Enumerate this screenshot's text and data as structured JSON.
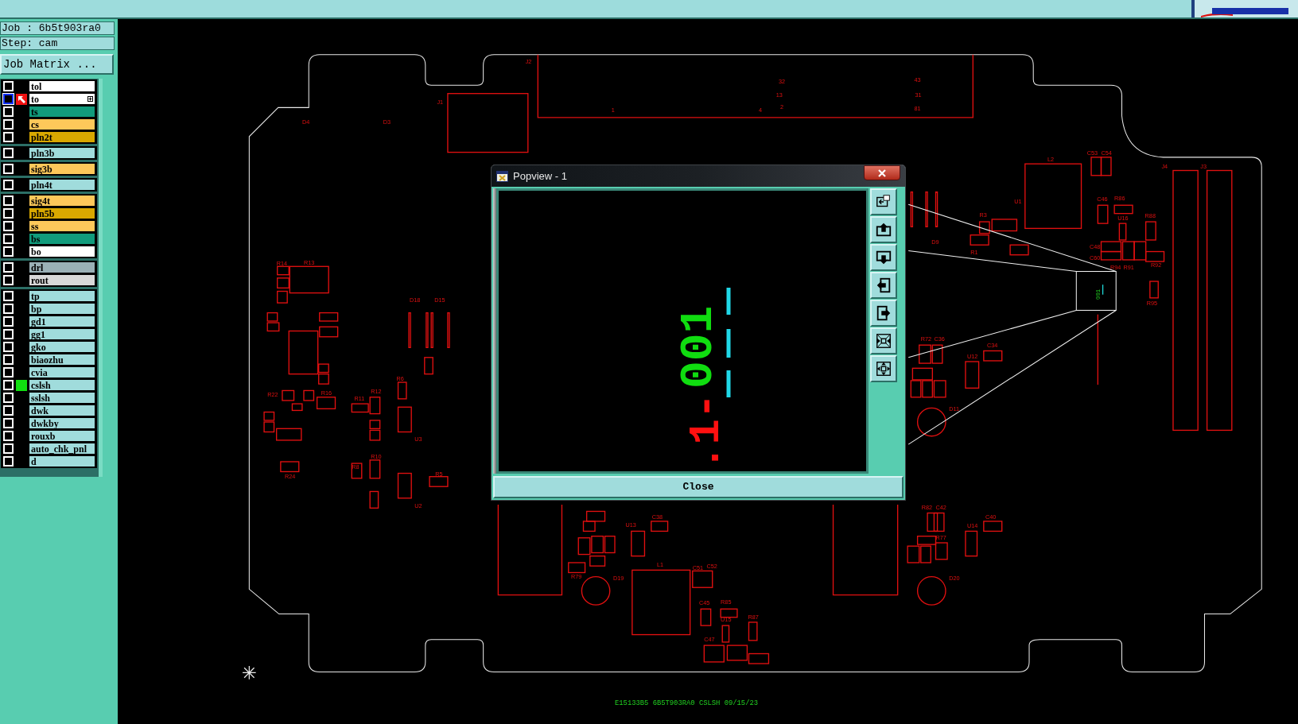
{
  "job_info": {
    "job": "Job : 6b5t903ra0",
    "step": "Step: cam"
  },
  "job_matrix_button": "Job Matrix ...",
  "layer_groups": [
    [
      {
        "name": "tol",
        "color": "#ffffff",
        "checked": false,
        "work": false,
        "affected": false
      },
      {
        "name": "to",
        "color": "#ffffff",
        "checked": false,
        "work": true,
        "affected": false
      },
      {
        "name": "ts",
        "color": "#119b7c",
        "checked": false,
        "work": false,
        "affected": false
      },
      {
        "name": "cs",
        "color": "#fdc85a",
        "checked": false,
        "work": false,
        "affected": false
      },
      {
        "name": "pln2t",
        "color": "#d9a800",
        "checked": false,
        "work": false,
        "affected": false
      }
    ],
    [
      {
        "name": "pln3b",
        "color": "#a0dcdc",
        "checked": false,
        "work": false,
        "affected": false
      }
    ],
    [
      {
        "name": "sig3b",
        "color": "#fdc85a",
        "checked": false,
        "work": false,
        "affected": false
      }
    ],
    [
      {
        "name": "pln4t",
        "color": "#a0dcdc",
        "checked": false,
        "work": false,
        "affected": false
      }
    ],
    [
      {
        "name": "sig4t",
        "color": "#fdc85a",
        "checked": false,
        "work": false,
        "affected": false
      },
      {
        "name": "pln5b",
        "color": "#d9a800",
        "checked": false,
        "work": false,
        "affected": false
      },
      {
        "name": "ss",
        "color": "#fdc85a",
        "checked": false,
        "work": false,
        "affected": false
      },
      {
        "name": "bs",
        "color": "#119b7c",
        "checked": false,
        "work": false,
        "affected": false
      },
      {
        "name": "bo",
        "color": "#ffffff",
        "checked": false,
        "work": false,
        "affected": false
      }
    ],
    [
      {
        "name": "drl",
        "color": "#9ab0b6",
        "checked": false,
        "work": false,
        "affected": false
      },
      {
        "name": "rout",
        "color": "#d8d8d8",
        "checked": false,
        "work": false,
        "affected": false
      }
    ],
    [
      {
        "name": "tp",
        "color": "#a0dcdc",
        "checked": false,
        "work": false,
        "affected": false
      },
      {
        "name": "bp",
        "color": "#a0dcdc",
        "checked": false,
        "work": false,
        "affected": false
      },
      {
        "name": "gd1",
        "color": "#a0dcdc",
        "checked": false,
        "work": false,
        "affected": false
      },
      {
        "name": "gg1",
        "color": "#a0dcdc",
        "checked": false,
        "work": false,
        "affected": false
      },
      {
        "name": "gko",
        "color": "#a0dcdc",
        "checked": false,
        "work": false,
        "affected": false
      },
      {
        "name": "biaozhu",
        "color": "#a0dcdc",
        "checked": false,
        "work": false,
        "affected": false
      },
      {
        "name": "cvia",
        "color": "#a0dcdc",
        "checked": false,
        "work": false,
        "affected": false
      },
      {
        "name": "cslsh",
        "color": "#a0dcdc",
        "checked": false,
        "work": false,
        "affected": true
      },
      {
        "name": "sslsh",
        "color": "#a0dcdc",
        "checked": false,
        "work": false,
        "affected": false
      },
      {
        "name": "dwk",
        "color": "#a0dcdc",
        "checked": false,
        "work": false,
        "affected": false
      },
      {
        "name": "dwkby",
        "color": "#a0dcdc",
        "checked": false,
        "work": false,
        "affected": false
      },
      {
        "name": "rouxb",
        "color": "#a0dcdc",
        "checked": false,
        "work": false,
        "affected": false
      },
      {
        "name": "auto_chk_pnl",
        "color": "#a0dcdc",
        "checked": false,
        "work": false,
        "affected": false
      },
      {
        "name": "d",
        "color": "#a0dcdc",
        "checked": false,
        "work": false,
        "affected": false
      }
    ]
  ],
  "board": {
    "labels": [
      "J2",
      "32",
      "43",
      "13",
      "31",
      "J1",
      "1",
      "4",
      "2",
      "81",
      "D4",
      "D3",
      "C53",
      "C54",
      "L2",
      "J4",
      "J3",
      "U1",
      "C46",
      "R86",
      "R3",
      "U16",
      "R88",
      "D9",
      "R1",
      "C48",
      "C60",
      "R14",
      "R13",
      "R94",
      "R91",
      "R92",
      "D18",
      "D15",
      "R95",
      "R72",
      "C36",
      "U12",
      "C34",
      "R6",
      "R22",
      "R16",
      "R11",
      "R12",
      "D11",
      "U3",
      "R10",
      "R24",
      "R8",
      "R5",
      "U2",
      "R82",
      "C42",
      "U13",
      "C38",
      "U14",
      "C40",
      "R77",
      "L1",
      "C51",
      "C52",
      "R79",
      "D19",
      "D20",
      "C45",
      "R85",
      "U15",
      "R87",
      "C47"
    ],
    "zoom_label": "001",
    "footer": "E15133B5 6B5T903RA0 CSLSH 09/15/23"
  },
  "popview": {
    "title": "Popview - 1",
    "preview_text": [
      {
        "text": ".1-",
        "color": "#ff1010"
      },
      {
        "text": "001",
        "color": "#10dd10"
      }
    ],
    "close_button": "Close"
  }
}
